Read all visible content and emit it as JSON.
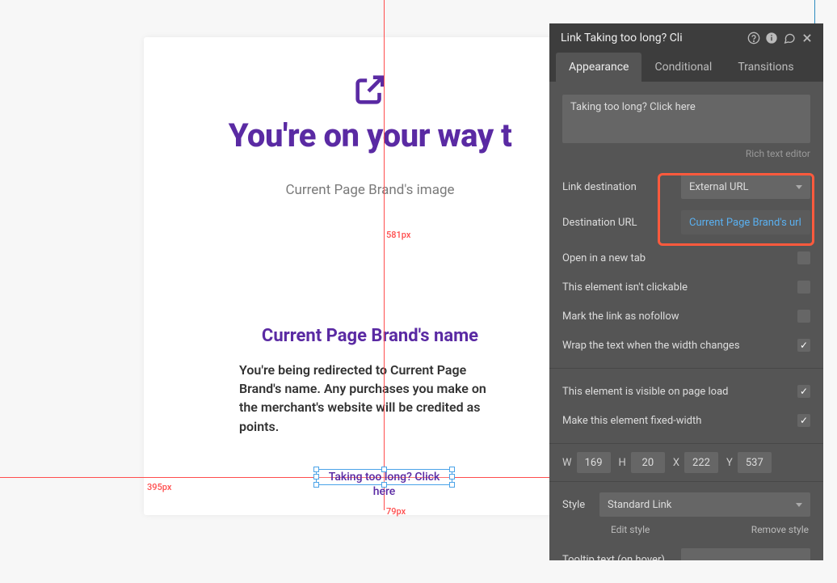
{
  "canvas": {
    "headline": "You're on your way t",
    "brand_image": "Current Page Brand's image",
    "brand_name": "Current Page Brand's name",
    "redirect_text": "You're being redirected to Current Page Brand's name. Any purchases you make on the merchant's website will be credited as points.",
    "selected_text": "Taking too long? Click here"
  },
  "measurements": {
    "left_label": "395px",
    "right_label": "581px",
    "bottom_label": "79px"
  },
  "panel": {
    "title": "Link Taking too long? Cli",
    "tabs": {
      "appearance": "Appearance",
      "conditional": "Conditional",
      "transitions": "Transitions"
    },
    "textarea_value": "Taking too long? Click here",
    "rich_text_label": "Rich text editor",
    "rows": {
      "link_destination": {
        "label": "Link destination",
        "value": "External URL"
      },
      "destination_url": {
        "label": "Destination URL",
        "value": "Current Page Brand's url"
      },
      "open_newtab": {
        "label": "Open in a new tab",
        "checked": false
      },
      "not_clickable": {
        "label": "This element isn't clickable",
        "checked": false
      },
      "nofollow": {
        "label": "Mark the link as nofollow",
        "checked": false
      },
      "wrap_text": {
        "label": "Wrap the text when the width changes",
        "checked": true
      },
      "visible_on_load": {
        "label": "This element is visible on page load",
        "checked": true
      },
      "fixed_width": {
        "label": "Make this element fixed-width",
        "checked": true
      }
    },
    "dims": {
      "w_label": "W",
      "w": "169",
      "h_label": "H",
      "h": "20",
      "x_label": "X",
      "x": "222",
      "y_label": "Y",
      "y": "537"
    },
    "style": {
      "label": "Style",
      "value": "Standard Link",
      "edit": "Edit style",
      "remove": "Remove style"
    },
    "tooltip_label": "Tooltip text (on hover)"
  }
}
